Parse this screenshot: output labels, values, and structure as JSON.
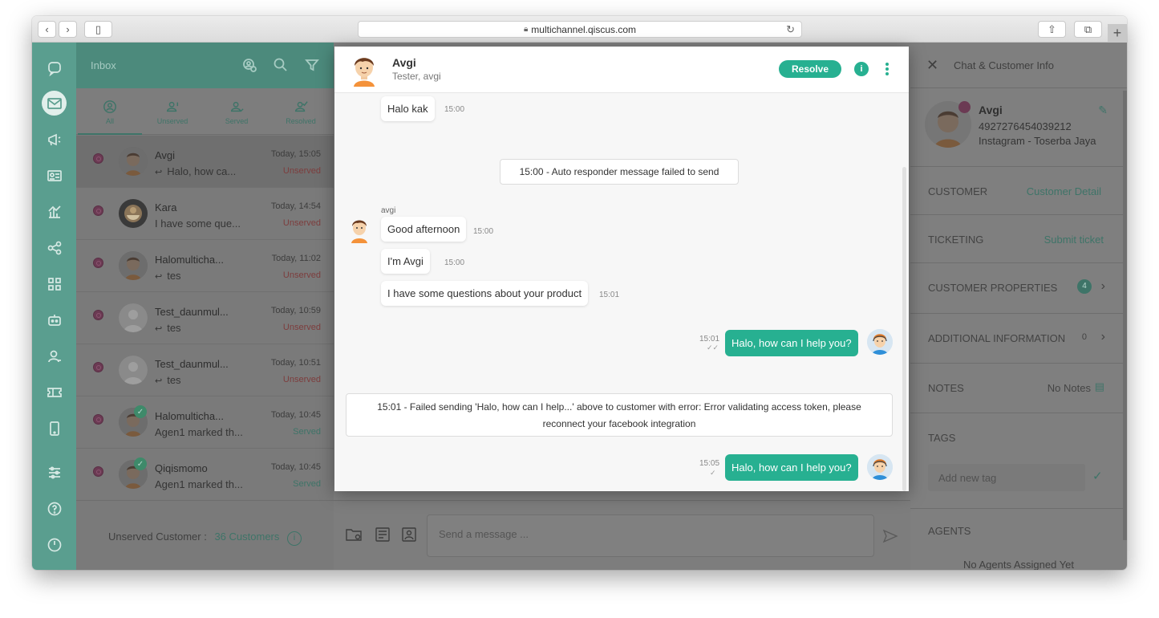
{
  "browser": {
    "url": "multichannel.qiscus.com"
  },
  "list": {
    "title": "Inbox",
    "tabs": [
      {
        "label": "All"
      },
      {
        "label": "Unserved"
      },
      {
        "label": "Served"
      },
      {
        "label": "Resolved"
      }
    ],
    "conversations": [
      {
        "name": "Avgi",
        "preview": "Halo, how ca...",
        "time": "Today, 15:05",
        "status": "Unserved",
        "reply": true
      },
      {
        "name": "Kara",
        "preview": "I have some que...",
        "time": "Today, 14:54",
        "status": "Unserved",
        "reply": false
      },
      {
        "name": "Halomulticha...",
        "preview": "tes",
        "time": "Today, 11:02",
        "status": "Unserved",
        "reply": true
      },
      {
        "name": "Test_daunmul...",
        "preview": "tes",
        "time": "Today, 10:59",
        "status": "Unserved",
        "reply": true
      },
      {
        "name": "Test_daunmul...",
        "preview": "tes",
        "time": "Today, 10:51",
        "status": "Unserved",
        "reply": true
      },
      {
        "name": "Halomulticha...",
        "preview": "Agen1 marked th...",
        "time": "Today, 10:45",
        "status": "Served",
        "reply": false
      },
      {
        "name": "Qiqismomo",
        "preview": "Agen1 marked th...",
        "time": "Today, 10:45",
        "status": "Served",
        "reply": false
      }
    ],
    "footer": {
      "label": "Unserved Customer :",
      "count": "36 Customers"
    }
  },
  "composer": {
    "placeholder": "Send a message ..."
  },
  "right_panel": {
    "title": "Chat & Customer Info",
    "profile": {
      "name": "Avgi",
      "id": "4927276454039212",
      "channel": "Instagram - Toserba Jaya"
    },
    "rows": {
      "customer": {
        "label": "CUSTOMER",
        "action": "Customer Detail"
      },
      "ticketing": {
        "label": "TICKETING",
        "action": "Submit ticket"
      },
      "properties": {
        "label": "CUSTOMER PROPERTIES",
        "count": "4"
      },
      "additional": {
        "label": "ADDITIONAL INFORMATION",
        "count": "0"
      },
      "notes": {
        "label": "NOTES",
        "action": "No Notes"
      },
      "tags": {
        "label": "TAGS",
        "placeholder": "Add new tag"
      },
      "agents": {
        "label": "AGENTS",
        "empty": "No Agents Assigned Yet"
      }
    }
  },
  "modal": {
    "name": "Avgi",
    "subtitle": "Tester, avgi",
    "resolve_label": "Resolve",
    "messages": {
      "m1": {
        "text": "Halo kak",
        "time": "15:00"
      },
      "sys1": "15:00 - Auto responder message failed to send",
      "sender": "avgi",
      "m2": {
        "text": "Good afternoon",
        "time": "15:00"
      },
      "m3": {
        "text": "I'm Avgi",
        "time": "15:00"
      },
      "m4": {
        "text": "I have some questions about your product",
        "time": "15:01"
      },
      "out1": {
        "text": "Halo, how can I help you?",
        "time": "15:01"
      },
      "sys2_line1": "15:01 - Failed sending 'Halo, how can I help...' above to customer with error: Error validating access token, please",
      "sys2_line2": "reconnect your facebook integration",
      "out2": {
        "text": "Halo, how can I help you?",
        "time": "15:05"
      }
    }
  },
  "colors": {
    "accent": "#27b091",
    "sidebar": "#5a9e8f",
    "unserved": "#e07070"
  }
}
